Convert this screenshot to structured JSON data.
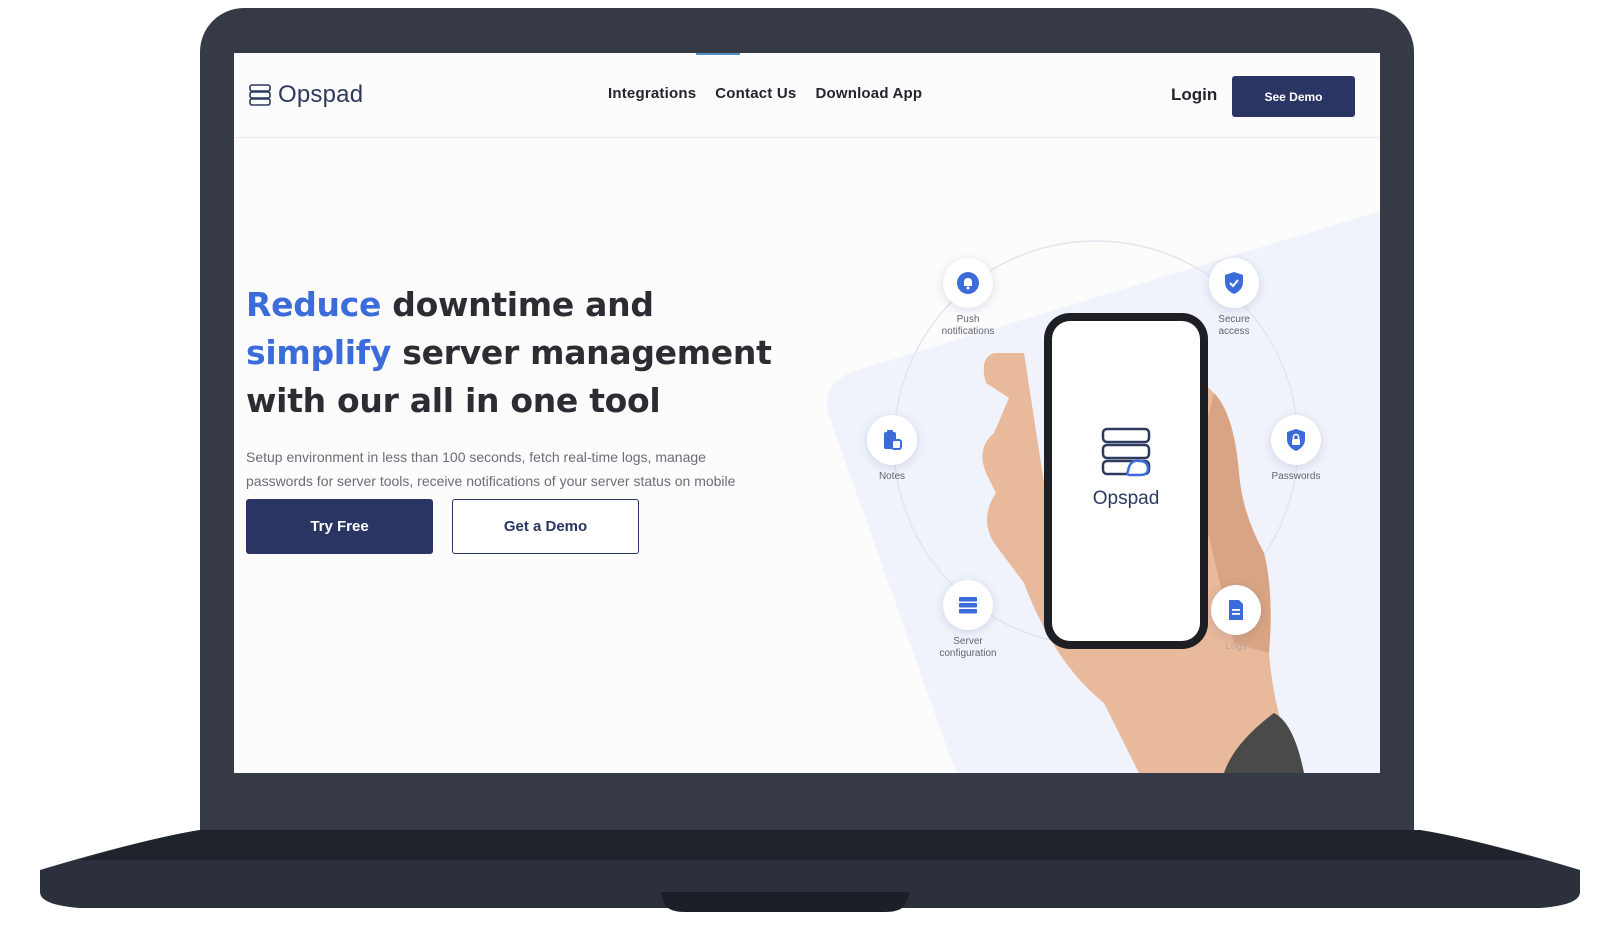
{
  "brand": {
    "name": "Opspad",
    "accent_color": "#3c6cd9",
    "primary_color": "#2a3563"
  },
  "nav": {
    "links": [
      "Integrations",
      "Contact Us",
      "Download App"
    ],
    "login": "Login",
    "see_demo": "See Demo"
  },
  "hero": {
    "line1_accent": "Reduce",
    "line1_rest": " downtime and",
    "line2_accent": "simplify",
    "line2_rest": " server management",
    "line3": "with our all in one tool",
    "subtitle_line1": "Setup environment in less than 100 seconds, fetch real-time logs, manage",
    "subtitle_line2": "passwords for server tools, receive notifications of your server status on mobile",
    "try_free": "Try Free",
    "get_demo": "Get a Demo"
  },
  "features": {
    "push": {
      "line1": "Push",
      "line2": "notifications",
      "icon": "bell-icon"
    },
    "secure": {
      "line1": "Secure",
      "line2": "access",
      "icon": "shield-check-icon"
    },
    "notes": {
      "line1": "Notes",
      "icon": "clipboard-icon"
    },
    "passwords": {
      "line1": "Passwords",
      "icon": "shield-lock-icon"
    },
    "server": {
      "line1": "Server",
      "line2": "configuration",
      "icon": "server-icon"
    },
    "logs": {
      "line1": "Logs",
      "icon": "document-icon"
    }
  },
  "phone": {
    "app_name": "Opspad"
  }
}
